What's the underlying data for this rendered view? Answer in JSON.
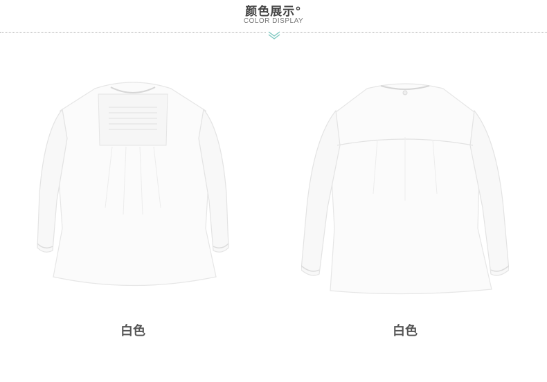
{
  "header": {
    "title": "颜色展示°",
    "subtitle": "COLOR DISPLAY"
  },
  "products": [
    {
      "view": "front",
      "color_label": "白色"
    },
    {
      "view": "back",
      "color_label": "白色"
    }
  ],
  "colors": {
    "garment": "#fbfbfb",
    "garment_shade": "#e9e9e9",
    "accent": "#7ec8c0"
  }
}
